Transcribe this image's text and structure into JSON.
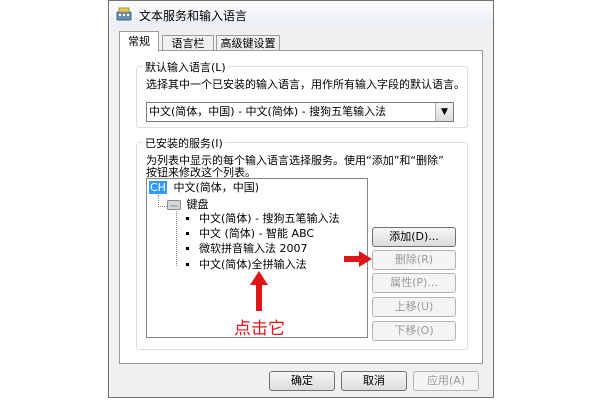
{
  "window": {
    "title": "文本服务和输入语言"
  },
  "tabs": [
    {
      "label": "常规",
      "active": true
    },
    {
      "label": "语言栏",
      "active": false
    },
    {
      "label": "高级键设置",
      "active": false
    }
  ],
  "default_language": {
    "group_title": "默认输入语言(L)",
    "description": "选择其中一个已安装的输入语言，用作所有输入字段的默认语言。",
    "selected_value": "中文(简体，中国) - 中文(简体) - 搜狗五笔输入法"
  },
  "installed_services": {
    "group_title": "已安装的服务(I)",
    "description_line1": "为列表中显示的每个输入语言选择服务。使用“添加”和“删除”",
    "description_line2": "按钮来修改这个列表。",
    "tree": {
      "language_badge": "CH",
      "language": "中文(简体，中国)",
      "category": "键盘",
      "items": [
        "中文(简体) - 搜狗五笔输入法",
        "中文 (简体) - 智能 ABC",
        "微软拼音输入法 2007",
        "中文(简体)全拼输入法"
      ]
    },
    "buttons": {
      "add": "添加(D)...",
      "remove": "删除(R)",
      "properties": "属性(P)...",
      "move_up": "上移(U)",
      "move_down": "下移(O)"
    }
  },
  "footer": {
    "ok": "确定",
    "cancel": "取消",
    "apply": "应用(A)"
  },
  "annotation": {
    "text": "点击它"
  },
  "colors": {
    "annotation_red": "#e0151a",
    "tree_selected": "#3399ff"
  }
}
